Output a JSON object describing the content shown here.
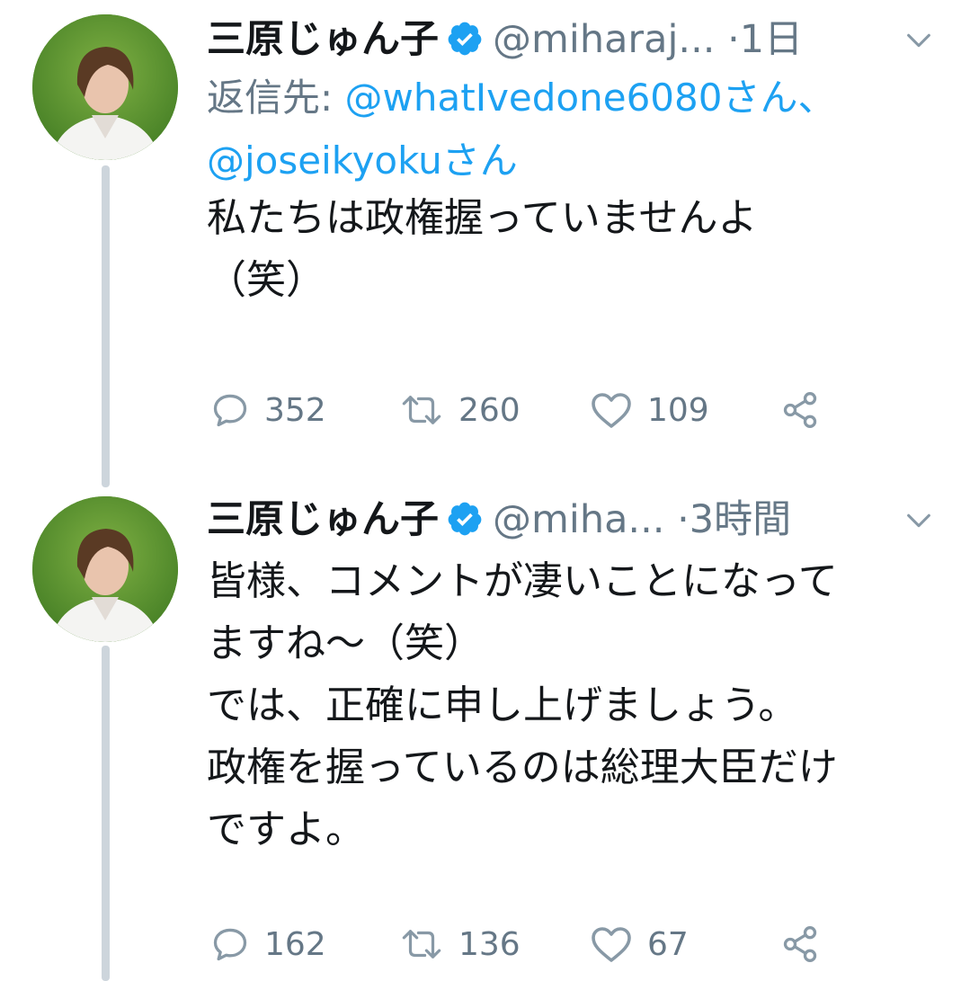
{
  "tweets": [
    {
      "name": "三原じゅん子",
      "handle": "@miharaj...",
      "separator": "·",
      "time": "1日",
      "reply_prefix": "返信先: ",
      "reply_mention1": "@whatIvedone6080さん、",
      "reply_mention2": "@joseikyokuさん",
      "text": "私たちは政権握っていませんよ\n（笑）",
      "replies": "352",
      "retweets": "260",
      "likes": "109"
    },
    {
      "name": "三原じゅん子",
      "handle": "@miha...",
      "separator": "·",
      "time": "3時間",
      "text": "皆様、コメントが凄いことになって\nますね〜（笑）\nでは、正確に申し上げましょう。\n政権を握っているのは総理大臣だけ\nですよ。",
      "replies": "162",
      "retweets": "136",
      "likes": "67"
    }
  ],
  "icons": {
    "verified": "verified-badge-icon",
    "chevron": "chevron-down-icon",
    "reply": "reply-icon",
    "retweet": "retweet-icon",
    "like": "heart-icon",
    "share": "share-icon"
  },
  "colors": {
    "accent": "#1da1f2",
    "muted": "#657786",
    "thread_line": "#cdd5dc"
  }
}
